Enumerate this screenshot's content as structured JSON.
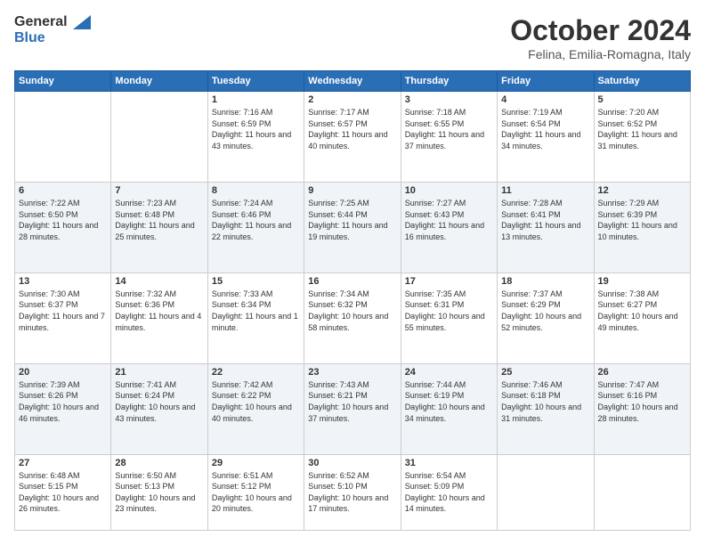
{
  "logo": {
    "text1": "General",
    "text2": "Blue"
  },
  "header": {
    "month": "October 2024",
    "location": "Felina, Emilia-Romagna, Italy"
  },
  "weekdays": [
    "Sunday",
    "Monday",
    "Tuesday",
    "Wednesday",
    "Thursday",
    "Friday",
    "Saturday"
  ],
  "weeks": [
    [
      {
        "day": "",
        "info": ""
      },
      {
        "day": "",
        "info": ""
      },
      {
        "day": "1",
        "info": "Sunrise: 7:16 AM\nSunset: 6:59 PM\nDaylight: 11 hours and 43 minutes."
      },
      {
        "day": "2",
        "info": "Sunrise: 7:17 AM\nSunset: 6:57 PM\nDaylight: 11 hours and 40 minutes."
      },
      {
        "day": "3",
        "info": "Sunrise: 7:18 AM\nSunset: 6:55 PM\nDaylight: 11 hours and 37 minutes."
      },
      {
        "day": "4",
        "info": "Sunrise: 7:19 AM\nSunset: 6:54 PM\nDaylight: 11 hours and 34 minutes."
      },
      {
        "day": "5",
        "info": "Sunrise: 7:20 AM\nSunset: 6:52 PM\nDaylight: 11 hours and 31 minutes."
      }
    ],
    [
      {
        "day": "6",
        "info": "Sunrise: 7:22 AM\nSunset: 6:50 PM\nDaylight: 11 hours and 28 minutes."
      },
      {
        "day": "7",
        "info": "Sunrise: 7:23 AM\nSunset: 6:48 PM\nDaylight: 11 hours and 25 minutes."
      },
      {
        "day": "8",
        "info": "Sunrise: 7:24 AM\nSunset: 6:46 PM\nDaylight: 11 hours and 22 minutes."
      },
      {
        "day": "9",
        "info": "Sunrise: 7:25 AM\nSunset: 6:44 PM\nDaylight: 11 hours and 19 minutes."
      },
      {
        "day": "10",
        "info": "Sunrise: 7:27 AM\nSunset: 6:43 PM\nDaylight: 11 hours and 16 minutes."
      },
      {
        "day": "11",
        "info": "Sunrise: 7:28 AM\nSunset: 6:41 PM\nDaylight: 11 hours and 13 minutes."
      },
      {
        "day": "12",
        "info": "Sunrise: 7:29 AM\nSunset: 6:39 PM\nDaylight: 11 hours and 10 minutes."
      }
    ],
    [
      {
        "day": "13",
        "info": "Sunrise: 7:30 AM\nSunset: 6:37 PM\nDaylight: 11 hours and 7 minutes."
      },
      {
        "day": "14",
        "info": "Sunrise: 7:32 AM\nSunset: 6:36 PM\nDaylight: 11 hours and 4 minutes."
      },
      {
        "day": "15",
        "info": "Sunrise: 7:33 AM\nSunset: 6:34 PM\nDaylight: 11 hours and 1 minute."
      },
      {
        "day": "16",
        "info": "Sunrise: 7:34 AM\nSunset: 6:32 PM\nDaylight: 10 hours and 58 minutes."
      },
      {
        "day": "17",
        "info": "Sunrise: 7:35 AM\nSunset: 6:31 PM\nDaylight: 10 hours and 55 minutes."
      },
      {
        "day": "18",
        "info": "Sunrise: 7:37 AM\nSunset: 6:29 PM\nDaylight: 10 hours and 52 minutes."
      },
      {
        "day": "19",
        "info": "Sunrise: 7:38 AM\nSunset: 6:27 PM\nDaylight: 10 hours and 49 minutes."
      }
    ],
    [
      {
        "day": "20",
        "info": "Sunrise: 7:39 AM\nSunset: 6:26 PM\nDaylight: 10 hours and 46 minutes."
      },
      {
        "day": "21",
        "info": "Sunrise: 7:41 AM\nSunset: 6:24 PM\nDaylight: 10 hours and 43 minutes."
      },
      {
        "day": "22",
        "info": "Sunrise: 7:42 AM\nSunset: 6:22 PM\nDaylight: 10 hours and 40 minutes."
      },
      {
        "day": "23",
        "info": "Sunrise: 7:43 AM\nSunset: 6:21 PM\nDaylight: 10 hours and 37 minutes."
      },
      {
        "day": "24",
        "info": "Sunrise: 7:44 AM\nSunset: 6:19 PM\nDaylight: 10 hours and 34 minutes."
      },
      {
        "day": "25",
        "info": "Sunrise: 7:46 AM\nSunset: 6:18 PM\nDaylight: 10 hours and 31 minutes."
      },
      {
        "day": "26",
        "info": "Sunrise: 7:47 AM\nSunset: 6:16 PM\nDaylight: 10 hours and 28 minutes."
      }
    ],
    [
      {
        "day": "27",
        "info": "Sunrise: 6:48 AM\nSunset: 5:15 PM\nDaylight: 10 hours and 26 minutes."
      },
      {
        "day": "28",
        "info": "Sunrise: 6:50 AM\nSunset: 5:13 PM\nDaylight: 10 hours and 23 minutes."
      },
      {
        "day": "29",
        "info": "Sunrise: 6:51 AM\nSunset: 5:12 PM\nDaylight: 10 hours and 20 minutes."
      },
      {
        "day": "30",
        "info": "Sunrise: 6:52 AM\nSunset: 5:10 PM\nDaylight: 10 hours and 17 minutes."
      },
      {
        "day": "31",
        "info": "Sunrise: 6:54 AM\nSunset: 5:09 PM\nDaylight: 10 hours and 14 minutes."
      },
      {
        "day": "",
        "info": ""
      },
      {
        "day": "",
        "info": ""
      }
    ]
  ]
}
